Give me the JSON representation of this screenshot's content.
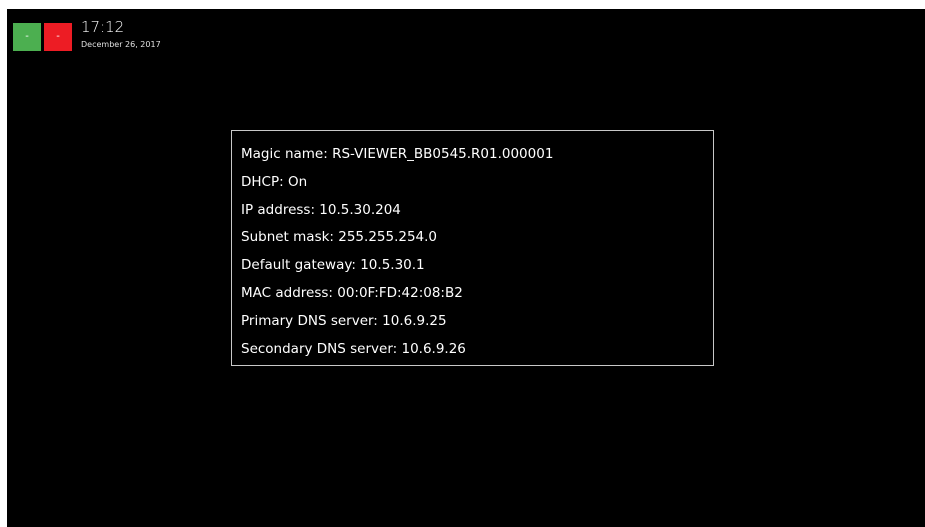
{
  "status": {
    "tile_green_label": "-",
    "tile_red_label": "-"
  },
  "clock": {
    "time": "17:12",
    "date": "December 26, 2017"
  },
  "network_info": {
    "rows": [
      "Magic name: RS-VIEWER_BB0545.R01.000001",
      "DHCP: On",
      "IP address: 10.5.30.204",
      "Subnet mask: 255.255.254.0",
      "Default gateway: 10.5.30.1",
      "MAC address: 00:0F:FD:42:08:B2",
      "Primary DNS server: 10.6.9.25",
      "Secondary DNS server: 10.6.9.26"
    ]
  },
  "colors": {
    "background": "#000000",
    "tile_green": "#4caf50",
    "tile_red": "#ed1c24",
    "panel_border": "#c8c8c8",
    "text": "#ffffff"
  }
}
